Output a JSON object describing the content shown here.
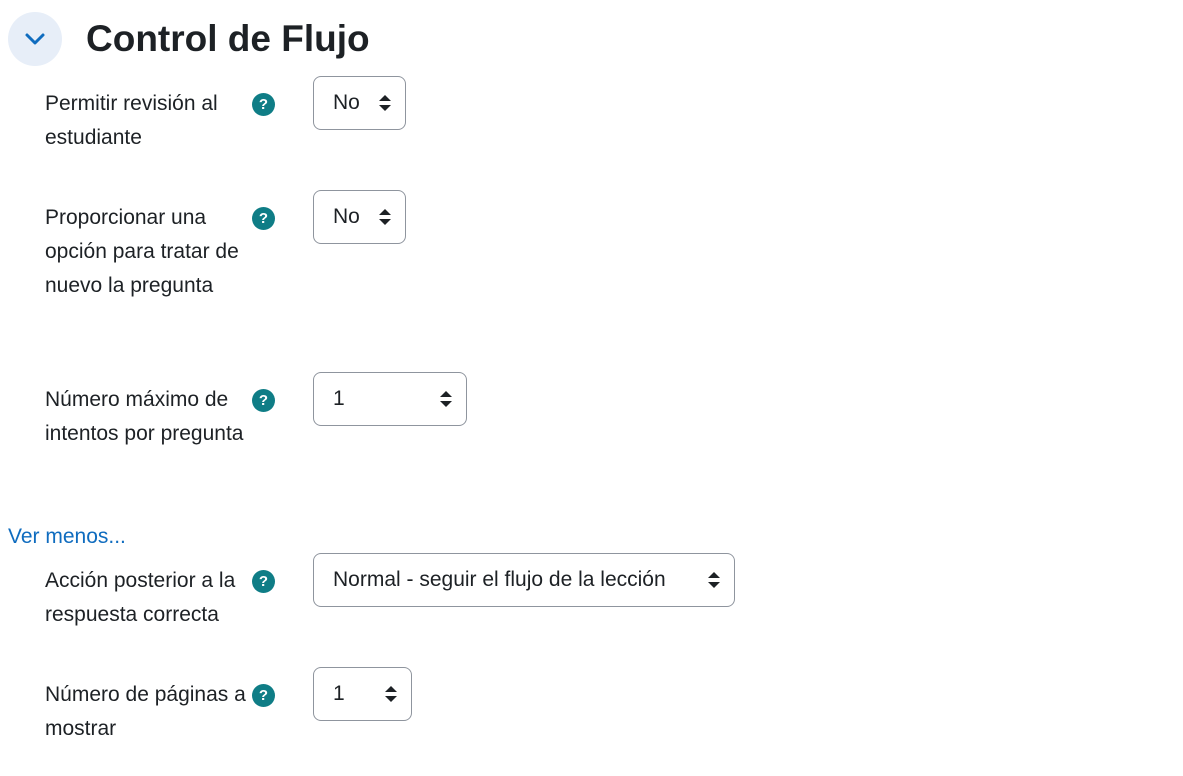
{
  "section": {
    "title": "Control de Flujo",
    "collapse_icon": "chevron-down-icon",
    "accent_color": "#0f6cbf",
    "help_color": "#0f7d86"
  },
  "fields": [
    {
      "label": "Permitir revisión al estudiante",
      "help": "?",
      "value": "No"
    },
    {
      "label": "Proporcionar una opción para tratar de nuevo la pregunta",
      "help": "?",
      "value": "No"
    },
    {
      "label": "Número máximo de intentos por pregunta",
      "help": "?",
      "value": "1"
    }
  ],
  "ver_menos": "Ver menos...",
  "advanced_fields": [
    {
      "label": "Acción posterior a la respuesta correcta",
      "help": "?",
      "value": "Normal - seguir el flujo de la lección"
    },
    {
      "label": "Número de páginas a mostrar",
      "help": "?",
      "value": "1"
    }
  ]
}
